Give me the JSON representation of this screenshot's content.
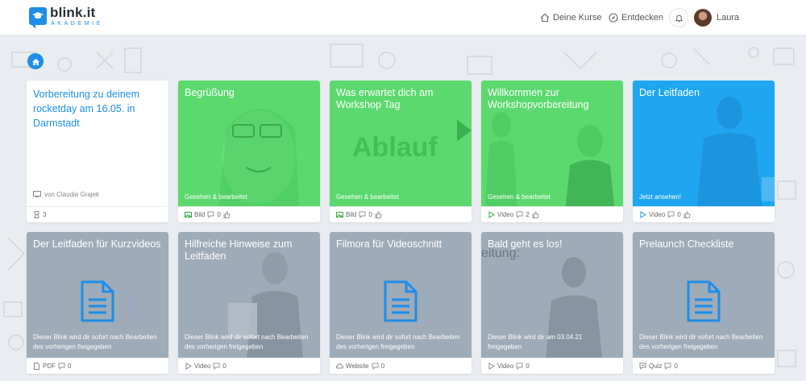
{
  "brand": {
    "name": "blink.it",
    "sub": "AKADEMIE"
  },
  "nav": {
    "courses": "Deine Kurse",
    "discover": "Entdecken",
    "user": "Laura"
  },
  "intro": {
    "title": "Vorbereitung zu deinem rocketday am 16.05. in Darmstadt",
    "author": "von Claudia Grajek",
    "count": "3"
  },
  "row1": [
    {
      "title": "Begrüßung",
      "status": "Gesehen & bearbeitet",
      "type": "Bild",
      "comments": "0",
      "color": "#5bd96f"
    },
    {
      "title": "Was erwartet dich am Workshop Tag",
      "status": "Gesehen & bearbeitet",
      "type": "Bild",
      "comments": "0",
      "color": "#5bd96f",
      "image_text": "Ablauf"
    },
    {
      "title": "Willkommen zur Workshopvorbereitung",
      "status": "Gesehen & bearbeitet",
      "type": "Video",
      "comments": "2",
      "color": "#5bd96f"
    },
    {
      "title": "Der Leitfaden",
      "status": "Jetzt ansehen!",
      "type": "Video",
      "comments": "0",
      "color": "#1fa6f0"
    }
  ],
  "row2": [
    {
      "title": "Der Leitfaden für Kurzvideos",
      "status": "Dieser Blink wird dir sofort nach Bearbeiten des vorherigen freigegeben",
      "type": "PDF",
      "comments": "0"
    },
    {
      "title": "Hilfreiche Hinweise zum Leitfaden",
      "status": "Dieser Blink wird dir sofort nach Bearbeiten des vorherigen freigegeben",
      "type": "Video",
      "comments": "0"
    },
    {
      "title": "Filmora für Videoschnitt",
      "status": "Dieser Blink wird dir sofort nach Bearbeiten des vorherigen freigegeben",
      "type": "Website",
      "comments": "0"
    },
    {
      "title": "Bald geht es los!",
      "status": "Dieser Blink wird dir am 03.04.21 freigegeben",
      "type": "Video",
      "comments": "0",
      "image_text": "eitung:"
    },
    {
      "title": "Prelaunch Checkliste",
      "status": "Dieser Blink wird dir sofort nach Bearbeiten des vorherigen freigegeben",
      "type": "Quiz",
      "comments": "0"
    }
  ],
  "colors": {
    "primary": "#1e8ee8",
    "done": "#5bd96f",
    "current": "#1fa6f0",
    "locked": "#9eabb8"
  }
}
